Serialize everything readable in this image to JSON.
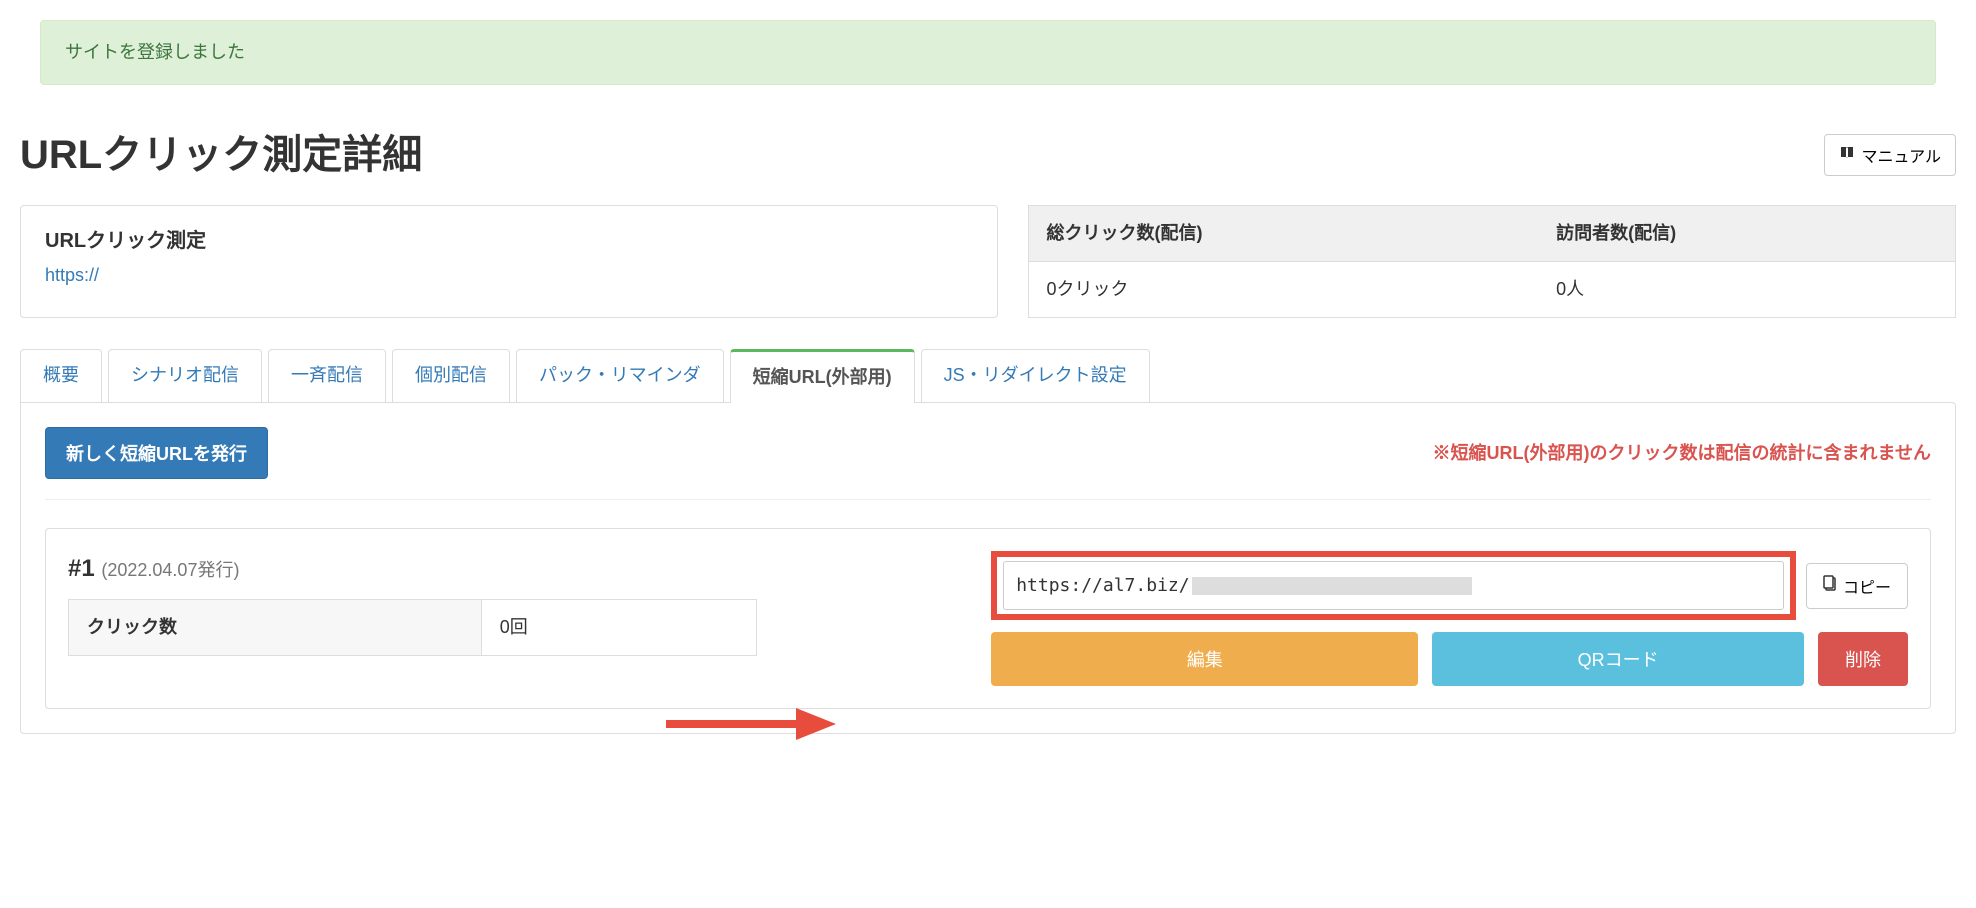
{
  "alert": {
    "message": "サイトを登録しました"
  },
  "page": {
    "title": "URLクリック測定詳細",
    "manual_label": "マニュアル"
  },
  "measurement": {
    "heading": "URLクリック測定",
    "url": "https://"
  },
  "stats": {
    "col1_header": "総クリック数(配信)",
    "col2_header": "訪問者数(配信)",
    "col1_value": "0クリック",
    "col2_value": "0人"
  },
  "tabs": {
    "overview": "概要",
    "scenario": "シナリオ配信",
    "broadcast": "一斉配信",
    "individual": "個別配信",
    "pack": "パック・リマインダ",
    "short_external": "短縮URL(外部用)",
    "js_redirect": "JS・リダイレクト設定"
  },
  "short_url": {
    "issue_button": "新しく短縮URLを発行",
    "warning": "※短縮URL(外部用)のクリック数は配信の統計に含まれません",
    "entry_id": "#1",
    "entry_date": "(2022.04.07発行)",
    "clicks_label": "クリック数",
    "clicks_value": "0回",
    "url_value": "https://al7.biz/",
    "copy_label": "コピー",
    "edit_label": "編集",
    "qr_label": "QRコード",
    "delete_label": "削除"
  }
}
